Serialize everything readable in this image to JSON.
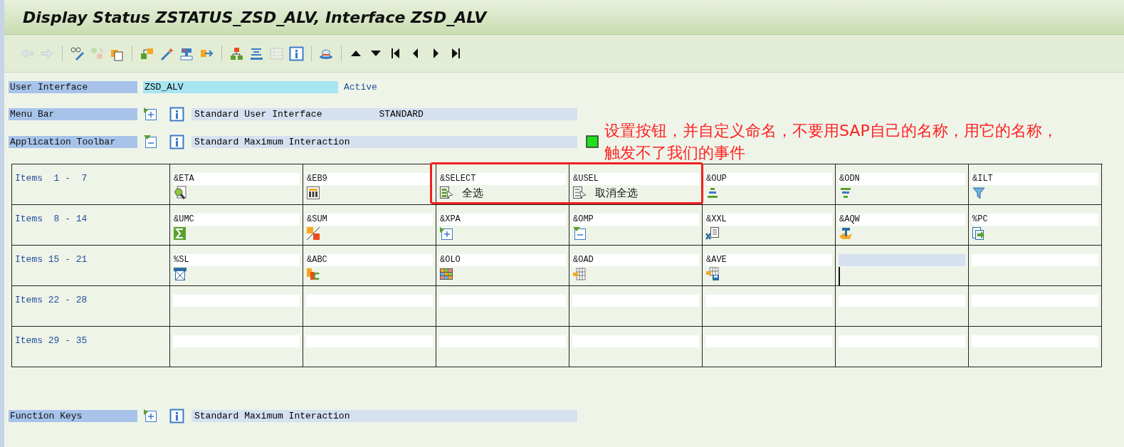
{
  "window": {
    "title": "Display Status ZSTATUS_ZSD_ALV, Interface ZSD_ALV"
  },
  "toolbar": [
    {
      "kind": "back",
      "disabled": true
    },
    {
      "kind": "forward",
      "disabled": true
    },
    {
      "kind": "sep"
    },
    {
      "kind": "glasses",
      "disabled": false
    },
    {
      "kind": "cycle",
      "disabled": true
    },
    {
      "kind": "copy",
      "disabled": false
    },
    {
      "kind": "sep"
    },
    {
      "kind": "shapes",
      "disabled": false
    },
    {
      "kind": "wand",
      "disabled": false
    },
    {
      "kind": "stamp",
      "disabled": false
    },
    {
      "kind": "export",
      "disabled": false
    },
    {
      "kind": "sep"
    },
    {
      "kind": "hierarchy",
      "disabled": false
    },
    {
      "kind": "align",
      "disabled": false
    },
    {
      "kind": "list",
      "disabled": true
    },
    {
      "kind": "info",
      "disabled": false
    },
    {
      "kind": "sep"
    },
    {
      "kind": "hat",
      "disabled": false
    },
    {
      "kind": "sep"
    },
    {
      "kind": "up",
      "disabled": false
    },
    {
      "kind": "down",
      "disabled": false
    },
    {
      "kind": "first",
      "disabled": false
    },
    {
      "kind": "prev",
      "disabled": false
    },
    {
      "kind": "next",
      "disabled": false
    },
    {
      "kind": "last",
      "disabled": false
    }
  ],
  "user_interface": {
    "label": "User Interface",
    "value": "ZSD_ALV",
    "status": "Active"
  },
  "menu_bar": {
    "label": "Menu Bar",
    "expanded": false,
    "description": "Standard User Interface",
    "code": "STANDARD"
  },
  "application_toolbar": {
    "label": "Application Toolbar",
    "expanded": true,
    "description": "Standard Maximum Interaction"
  },
  "annotation": {
    "text": "设置按钮，并自定义命名，不要用SAP自己的名称，用它的名称，触发不了我们的事件"
  },
  "items_table": {
    "rows": [
      {
        "label": "Items  1 -  7",
        "cells": [
          {
            "code": "&ETA",
            "kind": "magnifier"
          },
          {
            "code": "&EB9",
            "kind": "columns"
          },
          {
            "code": "&SELECT",
            "kind": "select",
            "text": "全选",
            "highlighted": true
          },
          {
            "code": "&USEL",
            "kind": "deselect",
            "text": "取消全选",
            "highlighted": true
          },
          {
            "code": "&OUP",
            "kind": "sortup"
          },
          {
            "code": "&ODN",
            "kind": "sortdown"
          },
          {
            "code": "&ILT",
            "kind": "filter"
          }
        ]
      },
      {
        "label": "Items  8 - 14",
        "cells": [
          {
            "code": "&UMC",
            "kind": "sigma"
          },
          {
            "code": "&SUM",
            "kind": "subtotal"
          },
          {
            "code": "&XPA",
            "kind": "expand"
          },
          {
            "code": "&OMP",
            "kind": "collapse"
          },
          {
            "code": "&XXL",
            "kind": "spreadsheet"
          },
          {
            "code": "&AQW",
            "kind": "wordtext"
          },
          {
            "code": "%PC",
            "kind": "savefile"
          }
        ]
      },
      {
        "label": "Items 15 - 21",
        "cells": [
          {
            "code": "%SL",
            "kind": "mail"
          },
          {
            "code": "&ABC",
            "kind": "abc"
          },
          {
            "code": "&OLO",
            "kind": "grid"
          },
          {
            "code": "&OAD",
            "kind": "layout"
          },
          {
            "code": "&AVE",
            "kind": "layoutsave"
          },
          {
            "focused": true
          },
          {
            "focused": false
          }
        ]
      },
      {
        "label": "Items 22 - 28",
        "cells": [
          {},
          {},
          {},
          {},
          {},
          {},
          {}
        ]
      },
      {
        "label": "Items 29 - 35",
        "cells": [
          {},
          {},
          {},
          {},
          {},
          {},
          {}
        ]
      }
    ]
  },
  "function_keys": {
    "label": "Function Keys",
    "expanded": false,
    "description": "Standard Maximum Interaction"
  }
}
